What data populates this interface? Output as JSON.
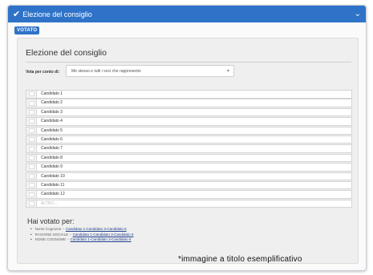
{
  "header": {
    "title": "Elezione del consiglio"
  },
  "badge": "VOTATO",
  "card": {
    "title": "Elezione del consiglio"
  },
  "vote": {
    "label": "Vota per conto di:",
    "selected": "Me stesso e tutti i soci che rappresento"
  },
  "candidates": [
    "Candidato 1",
    "Candidato 2",
    "Candidato 3",
    "Candidato 4",
    "Candidato 5",
    "Candidato 6",
    "Candidato 7",
    "Candidato 8",
    "Candidato 9",
    "Candidato 10",
    "Candidato 11",
    "Candidato 12"
  ],
  "altro_placeholder": "ALTRO...",
  "voted": {
    "title": "Hai votato per:",
    "entries": [
      {
        "holder": "Nome Cognome",
        "choices": "Candidato 1-Candidato 3-Candidato 6"
      },
      {
        "holder": "RAGIONE SOCIALE",
        "choices": "Candidato 1-Candidato 3-Candidato 6"
      },
      {
        "holder": "NOME COGNOME",
        "choices": "Candidato 1-Candidato 3-Candidato 6"
      }
    ]
  },
  "caption": "*immagine a titolo esemplificativo",
  "colors": {
    "accent": "#2f73c8"
  }
}
